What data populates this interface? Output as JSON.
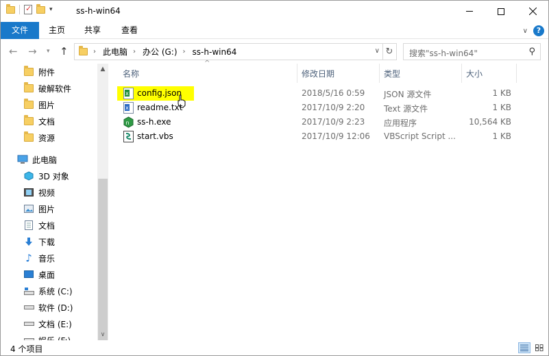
{
  "window": {
    "title": "ss-h-win64"
  },
  "ribbon": {
    "tabs": [
      {
        "label": "文件"
      },
      {
        "label": "主页"
      },
      {
        "label": "共享"
      },
      {
        "label": "查看"
      }
    ]
  },
  "address": {
    "crumbs": [
      "此电脑",
      "办公 (G:)",
      "ss-h-win64"
    ],
    "search_placeholder": "搜索\"ss-h-win64\""
  },
  "navpane": {
    "quick_access": [
      {
        "label": "附件"
      },
      {
        "label": "破解软件"
      },
      {
        "label": "图片"
      },
      {
        "label": "文档"
      },
      {
        "label": "资源"
      }
    ],
    "this_pc": {
      "label": "此电脑"
    },
    "pc_items": [
      {
        "label": "3D 对象",
        "icon": "3d-objects-icon"
      },
      {
        "label": "视频",
        "icon": "video-icon"
      },
      {
        "label": "图片",
        "icon": "pictures-icon"
      },
      {
        "label": "文档",
        "icon": "documents-icon"
      },
      {
        "label": "下载",
        "icon": "download-icon"
      },
      {
        "label": "音乐",
        "icon": "music-icon"
      },
      {
        "label": "桌面",
        "icon": "desktop-icon"
      },
      {
        "label": "系统 (C:)",
        "icon": "drive-icon"
      },
      {
        "label": "软件 (D:)",
        "icon": "drive-icon"
      },
      {
        "label": "文档 (E:)",
        "icon": "drive-icon"
      },
      {
        "label": "娱乐 (F:)",
        "icon": "drive-icon"
      }
    ]
  },
  "columns": {
    "name": "名称",
    "date": "修改日期",
    "type": "类型",
    "size": "大小"
  },
  "files": [
    {
      "name": "config.json",
      "date": "2018/5/16 0:59",
      "type": "JSON 源文件",
      "size": "1 KB",
      "icon": "json-file-icon",
      "highlighted": true
    },
    {
      "name": "readme.txt",
      "date": "2017/10/9 2:20",
      "type": "Text 源文件",
      "size": "1 KB",
      "icon": "text-file-icon"
    },
    {
      "name": "ss-h.exe",
      "date": "2017/10/9 2:23",
      "type": "应用程序",
      "size": "10,564 KB",
      "icon": "exe-file-icon"
    },
    {
      "name": "start.vbs",
      "date": "2017/10/9 12:06",
      "type": "VBScript Script ...",
      "size": "1 KB",
      "icon": "vbs-file-icon"
    }
  ],
  "status": {
    "item_count": "4 个项目"
  },
  "colors": {
    "accent": "#1979ca",
    "highlight": "#ffff00"
  }
}
